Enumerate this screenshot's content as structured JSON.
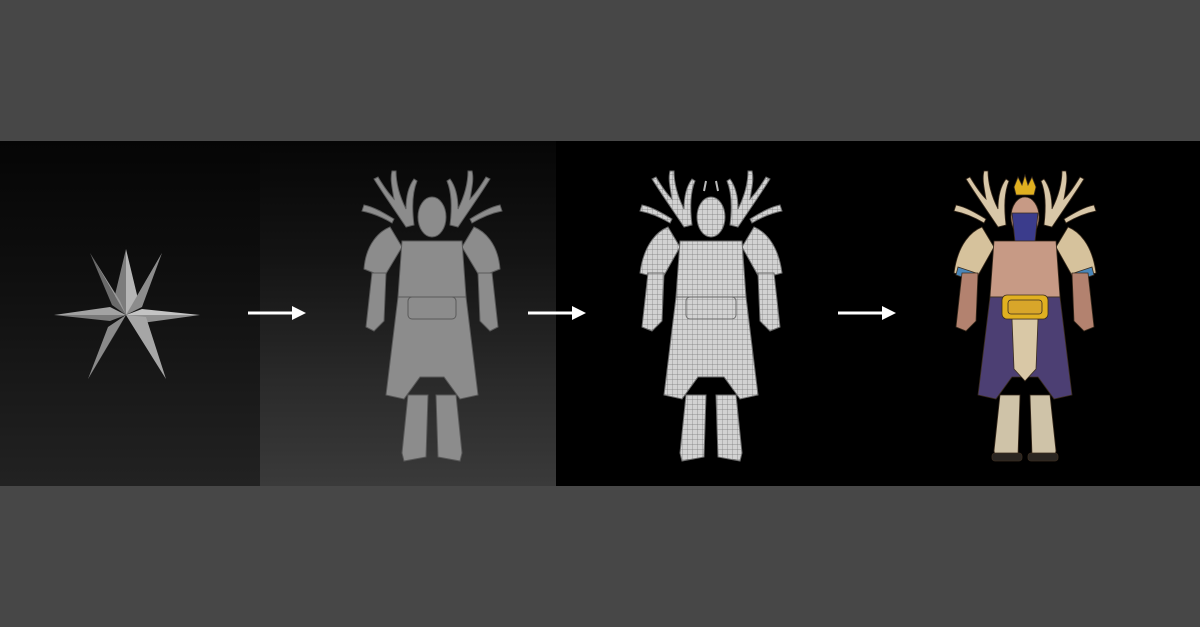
{
  "stages": [
    {
      "name": "primitive-star",
      "tone": "#8a8a8a"
    },
    {
      "name": "clay-sculpt",
      "tone": "#8e8e8e"
    },
    {
      "name": "wireframe-retopology",
      "tone": "#c9c9c9"
    },
    {
      "name": "textured-final",
      "tone": "#6a5a8e"
    }
  ],
  "colors": {
    "page_background": "#474747",
    "strip_background": "#000000",
    "arrow": "#ffffff",
    "antler": "#d8c7a8",
    "robe": "#4c3f73",
    "gold": "#e0b020",
    "skin": "#c79a85",
    "hair": "#3b3c8c"
  },
  "icons": [
    "star-icon",
    "arrow-right-icon"
  ]
}
